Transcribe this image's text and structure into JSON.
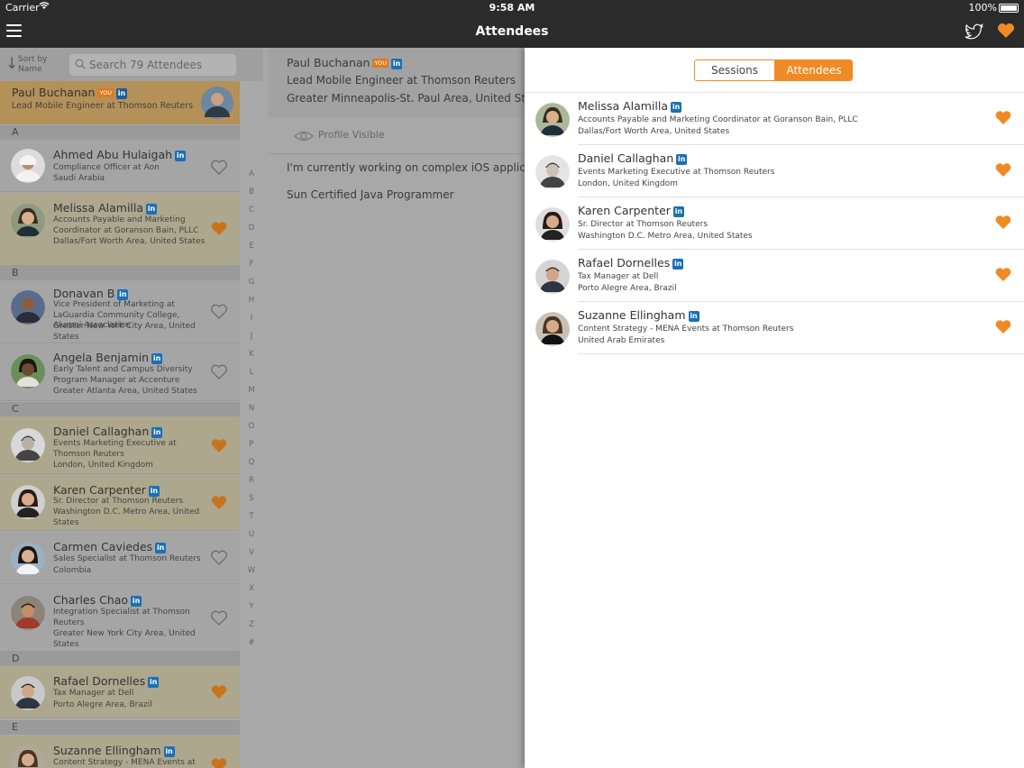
{
  "status_bar": {
    "carrier": "Carrier",
    "time": "9:58 AM",
    "battery": "100%"
  },
  "nav": {
    "title": "Attendees",
    "icons": [
      "menu-icon",
      "twitter-icon",
      "heart-icon"
    ]
  },
  "left_list": {
    "sort_line1": "Sort by",
    "sort_line2": "Name",
    "search_placeholder": "Search 79 Attendees",
    "me": {
      "name": "Paul Buchanan",
      "badge": "YOU",
      "li": "in",
      "role": "Lead Mobile Engineer at Thomson Reuters"
    },
    "sections": [
      "A",
      "B",
      "C",
      "D",
      "E"
    ],
    "rows": [
      {
        "name": "Ahmed Abu Hulaigah",
        "lines": [
          "Compliance Officer at Aon",
          "Saudi Arabia"
        ],
        "favorite": false
      },
      {
        "name": "Melissa Alamilla",
        "lines": [
          "Accounts Payable and Marketing Coordinator at Goranson Bain, PLLC",
          "Dallas/Fort Worth Area, United States"
        ],
        "favorite": true
      },
      {
        "name": "Donavan B",
        "lines": [
          "Vice President of Marketing at LaGuardia Community College, Alumni Association",
          "Greater New York City Area, United States"
        ],
        "favorite": false
      },
      {
        "name": "Angela Benjamin",
        "lines": [
          "Early Talent and Campus Diversity Program Manager at Accenture",
          "Greater Atlanta Area, United States"
        ],
        "favorite": false
      },
      {
        "name": "Daniel Callaghan",
        "lines": [
          "Events Marketing Executive at Thomson Reuters",
          "London, United Kingdom"
        ],
        "favorite": true
      },
      {
        "name": "Karen Carpenter",
        "lines": [
          "Sr. Director at Thomson Reuters",
          "Washington D.C. Metro Area, United States"
        ],
        "favorite": true
      },
      {
        "name": "Carmen Caviedes",
        "lines": [
          "Sales Specialist at Thomson Reuters",
          "Colombia"
        ],
        "favorite": false
      },
      {
        "name": "Charles Chao",
        "lines": [
          "Integration Specialist at Thomson Reuters",
          "Greater New York City Area, United States"
        ],
        "favorite": false
      },
      {
        "name": "Rafael Dornelles",
        "lines": [
          "Tax Manager at Dell",
          "Porto Alegre Area, Brazil"
        ],
        "favorite": true
      },
      {
        "name": "Suzanne Ellingham",
        "lines": [
          "Content Strategy - MENA Events at"
        ],
        "favorite": true
      }
    ],
    "index": [
      "A",
      "B",
      "C",
      "D",
      "E",
      "F",
      "G",
      "H",
      "I",
      "J",
      "K",
      "L",
      "M",
      "N",
      "O",
      "P",
      "Q",
      "R",
      "S",
      "T",
      "U",
      "V",
      "W",
      "X",
      "Y",
      "Z",
      "#"
    ]
  },
  "detail": {
    "name": "Paul Buchanan",
    "badge": "YOU",
    "li": "in",
    "role": "Lead Mobile Engineer at Thomson Reuters",
    "location": "Greater Minneapolis-St. Paul Area, United States",
    "visibility": "Profile Visible",
    "bio1": "I'm currently working on complex iOS applications",
    "bio2": "Sun Certified Java Programmer"
  },
  "favorites_panel": {
    "tabs": [
      "Sessions",
      "Attendees"
    ],
    "selected_tab": "Attendees",
    "rows": [
      {
        "name": "Melissa Alamilla",
        "l1": "Accounts Payable and Marketing Coordinator at Goranson Bain, PLLC",
        "l2": "Dallas/Fort Worth Area, United States"
      },
      {
        "name": "Daniel Callaghan",
        "l1": "Events Marketing Executive at Thomson Reuters",
        "l2": "London, United Kingdom"
      },
      {
        "name": "Karen Carpenter",
        "l1": "Sr. Director at Thomson Reuters",
        "l2": "Washington D.C. Metro Area, United States"
      },
      {
        "name": "Rafael Dornelles",
        "l1": "Tax Manager at Dell",
        "l2": "Porto Alegre Area, Brazil"
      },
      {
        "name": "Suzanne Ellingham",
        "l1": "Content Strategy - MENA Events at Thomson Reuters",
        "l2": "United Arab Emirates"
      }
    ]
  },
  "colors": {
    "accent": "#f08a24",
    "nav_bg": "#2b2b2b",
    "linkedin": "#1b6fb5"
  }
}
